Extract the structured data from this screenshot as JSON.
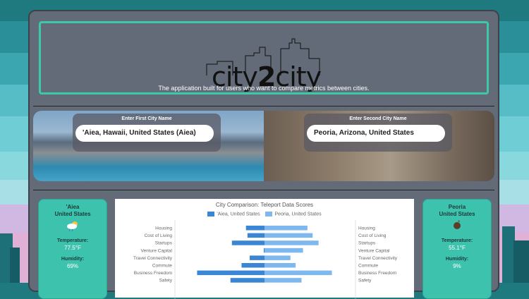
{
  "header": {
    "tagline": "The application built for users who want to compare metrics between cities.",
    "logo_left": "city",
    "logo_num": "2",
    "logo_right": "city"
  },
  "inputs": {
    "first_label": "Enter First City Name",
    "first_value": "'Aiea, Hawaii, United States (Aiea)",
    "second_label": "Enter Second City Name",
    "second_value": "Peoria, Arizona, United States"
  },
  "left_card": {
    "city": "'Aiea",
    "country": "United States",
    "weather_icon": "partly-cloudy-rain-icon",
    "temp_label": "Temperature:",
    "temp_value": "77.5°F",
    "humidity_label": "Humidity:",
    "humidity_value": "69%"
  },
  "right_card": {
    "city": "Peoria",
    "country": "United States",
    "weather_icon": "moon-cloud-icon",
    "temp_label": "Temperature:",
    "temp_value": "55.1°F",
    "humidity_label": "Humidity:",
    "humidity_value": "9%"
  },
  "chart_data": {
    "type": "bar",
    "title": "City Comparison: Teleport Data Scores",
    "categories": [
      "Housing",
      "Cost of Living",
      "Startups",
      "Venture Capital",
      "Travel Connectivity",
      "Commute",
      "Business Freedom",
      "Safety"
    ],
    "series": [
      {
        "name": "'Aiea, United States",
        "color": "#3a86d4",
        "values": [
          2.5,
          2.3,
          4.4,
          0.1,
          2.0,
          3.1,
          9.1,
          4.6
        ]
      },
      {
        "name": "Peoria, United States",
        "color": "#7fb8ee",
        "values": [
          5.8,
          6.5,
          7.3,
          5.2,
          3.5,
          4.2,
          9.1,
          5.0
        ]
      }
    ]
  }
}
